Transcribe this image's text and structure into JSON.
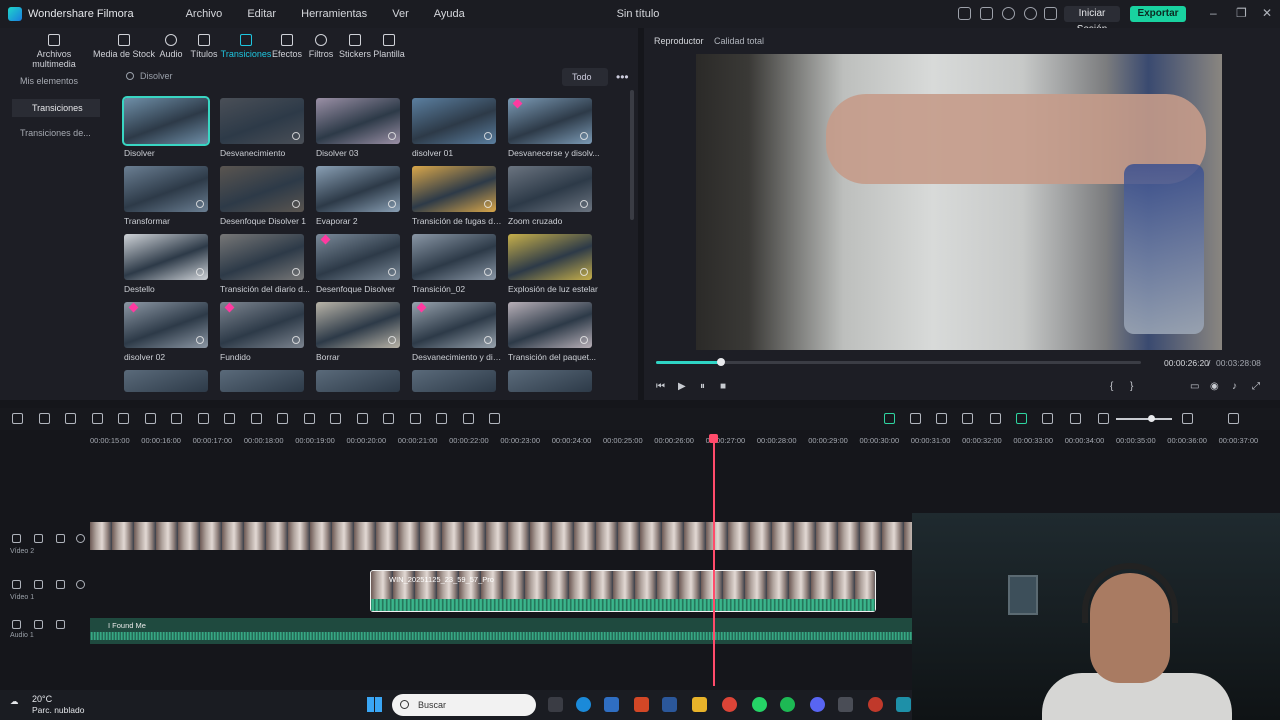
{
  "titlebar": {
    "app_name": "Wondershare Filmora",
    "menu": [
      "Archivo",
      "Editar",
      "Herramientas",
      "Ver",
      "Ayuda"
    ],
    "document": "Sin título",
    "login": "Iniciar Sesión",
    "export": "Exportar"
  },
  "library": {
    "tabs": [
      "Archivos multimedia",
      "Media de Stock",
      "Audio",
      "Títulos",
      "Transiciones",
      "Efectos",
      "Filtros",
      "Stickers",
      "Plantilla"
    ],
    "active_tab": "Transiciones",
    "sidebar": [
      "Mis elementos",
      "Transiciones",
      "Transiciones de..."
    ],
    "search_query": "Disolver",
    "filter": "Todo",
    "items": [
      {
        "label": "Disolver",
        "selected": true,
        "premium": false
      },
      {
        "label": "Desvanecimiento",
        "premium": false
      },
      {
        "label": "Disolver 03",
        "premium": false
      },
      {
        "label": "disolver 01",
        "premium": false
      },
      {
        "label": "Desvanecerse y disolv...",
        "premium": true
      },
      {
        "label": "Transformar",
        "premium": false
      },
      {
        "label": "Desenfoque Disolver 1",
        "premium": false
      },
      {
        "label": "Evaporar 2",
        "premium": false
      },
      {
        "label": "Transición de fugas de...",
        "premium": false
      },
      {
        "label": "Zoom cruzado",
        "premium": false
      },
      {
        "label": "Destello",
        "premium": false
      },
      {
        "label": "Transición del diario d...",
        "premium": false
      },
      {
        "label": "Desenfoque Disolver",
        "premium": true
      },
      {
        "label": "Transición_02",
        "premium": false
      },
      {
        "label": "Explosión de luz estelar",
        "premium": false
      },
      {
        "label": "disolver 02",
        "premium": true
      },
      {
        "label": "Fundido",
        "premium": true
      },
      {
        "label": "Borrar",
        "premium": false
      },
      {
        "label": "Desvanecimiento y dis...",
        "premium": true
      },
      {
        "label": "Transición del paquet...",
        "premium": false
      }
    ]
  },
  "player": {
    "label": "Reproductor",
    "quality": "Calidad total",
    "current_time": "00:00:26:20",
    "separator": "/",
    "total_time": "00:03:28:08",
    "progress": 0.133
  },
  "timeline": {
    "ticks": [
      "00:00:15:00",
      "00:00:16:00",
      "00:00:17:00",
      "00:00:18:00",
      "00:00:19:00",
      "00:00:20:00",
      "00:00:21:00",
      "00:00:22:00",
      "00:00:23:00",
      "00:00:24:00",
      "00:00:25:00",
      "00:00:26:00",
      "00:00:27:00",
      "00:00:28:00",
      "00:00:29:00",
      "00:00:30:00",
      "00:00:31:00",
      "00:00:32:00",
      "00:00:33:00",
      "00:00:34:00",
      "00:00:35:00",
      "00:00:36:00",
      "00:00:37:00"
    ],
    "tracks": [
      {
        "label": "Vídeo 2"
      },
      {
        "label": "Vídeo 1"
      },
      {
        "label": "Audio 1"
      }
    ],
    "clip_video1": "WIN_20251125_23_59_57_Pro",
    "clip_audio": "I Found Me"
  },
  "taskbar": {
    "temperature": "20°C",
    "weather": "Parc. nublado",
    "search_placeholder": "Buscar"
  },
  "colors": {
    "accent": "#19d2a0",
    "active_tab": "#1ec6e0",
    "playhead": "#ff4b6b"
  }
}
